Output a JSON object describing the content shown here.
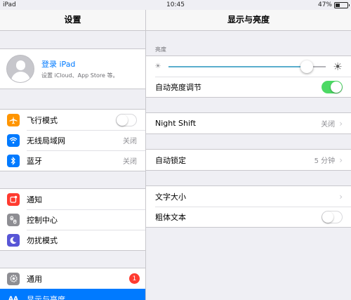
{
  "status_bar": {
    "device": "iPad",
    "time": "10:45",
    "battery_percent": "47%",
    "battery_level": 0.47
  },
  "master": {
    "title": "设置",
    "account": {
      "title": "登录 iPad",
      "subtitle": "设置 iCloud、App Store 等。"
    },
    "groups": [
      [
        {
          "label": "飞行模式",
          "icon": "airplane-icon",
          "color": "#ff9500",
          "toggle": false
        },
        {
          "label": "无线局域网",
          "icon": "wifi-icon",
          "color": "#007aff",
          "value": "关闭"
        },
        {
          "label": "蓝牙",
          "icon": "bluetooth-icon",
          "color": "#007aff",
          "value": "关闭"
        }
      ],
      [
        {
          "label": "通知",
          "icon": "notifications-icon",
          "color": "#ff3b30"
        },
        {
          "label": "控制中心",
          "icon": "control-center-icon",
          "color": "#8e8e93"
        },
        {
          "label": "勿扰模式",
          "icon": "moon-icon",
          "color": "#5856d6"
        }
      ],
      [
        {
          "label": "通用",
          "icon": "gear-icon",
          "color": "#8e8e93",
          "badge": "1"
        },
        {
          "label": "显示与亮度",
          "icon": "display-brightness-icon",
          "color": "#007aff",
          "icon_text": "AA",
          "selected": true
        }
      ]
    ]
  },
  "detail": {
    "title": "显示与亮度",
    "brightness_label": "亮度",
    "brightness_level": 0.88,
    "auto_brightness": {
      "label": "自动亮度调节",
      "on": true
    },
    "night_shift": {
      "label": "Night Shift",
      "value": "关闭"
    },
    "auto_lock": {
      "label": "自动锁定",
      "value": "5 分钟"
    },
    "text_size": {
      "label": "文字大小"
    },
    "bold_text": {
      "label": "粗体文本",
      "on": false
    }
  },
  "colors": {
    "accent": "#007aff",
    "toggle_on": "#4cd964",
    "badge": "#ff3b30"
  }
}
